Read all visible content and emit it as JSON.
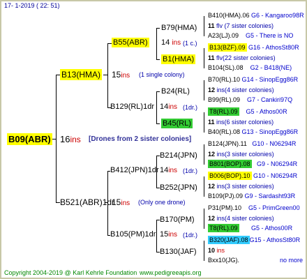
{
  "header": {
    "date": "17-  1-2019 ( 22: 51)"
  },
  "footer": {
    "copyright": "Copyright 2004-2019 @ Karl Kehrle Foundation",
    "site": "www.pedigreeapis.org"
  },
  "root": {
    "id": "B09(ABR)",
    "count": "16",
    "unit": "ins",
    "note": "[Drones from 2 sister colonies]"
  },
  "g1": [
    {
      "id": "B13(HMA)",
      "count": "15",
      "unit": "ins",
      "note": "(1 single colony)"
    },
    {
      "id": "B521(ABR)1dr",
      "count": "15",
      "unit": "ins",
      "note": "(Only one drone)"
    }
  ],
  "g2": [
    {
      "id": "B55(ABR)",
      "count": "14",
      "unit": "ins",
      "note": "(1 c.)"
    },
    {
      "id": "B129(RL)1dr",
      "count": "14",
      "unit": "ins",
      "note": "(1dr.)"
    },
    {
      "id": "B412(JPN)1dr",
      "count": "14",
      "unit": "ins",
      "note": "(1dr.)"
    },
    {
      "id": "B105(PM)1dr",
      "count": "15",
      "unit": "ins",
      "note": "(1dr.)"
    }
  ],
  "g3": [
    {
      "id": "B79(HMA)"
    },
    {
      "id": "B1(HMA)"
    },
    {
      "id": "B24(RL)"
    },
    {
      "id": "B45(RL)"
    },
    {
      "id": "B214(JPN)"
    },
    {
      "id": "B252(JPN)"
    },
    {
      "id": "B170(PM)"
    },
    {
      "id": "B130(JAF)"
    }
  ],
  "g4": [
    {
      "top": "B410(HMA).06",
      "topnote": "G6 - Kangaroo98R",
      "count": "11",
      "note": "flv (7 sister colonies)",
      "bot": "A23(LJ).09",
      "botnote": "G5 - There is NO"
    },
    {
      "top": "B13(BZF).09",
      "topnote": "G16 - AthosSt80R",
      "count": "11",
      "note": "flv(22 sister colonies)",
      "bot": "B104(SL).08",
      "botnote": "G2 - B418(NE)"
    },
    {
      "top": "B70(RL).10",
      "topnote": "G14 - SinopEgg86R",
      "count": "12",
      "note": "ins(4 sister colonies)",
      "bot": "B99(RL).09",
      "botnote": "G7 - Cankiri97Q"
    },
    {
      "top": "T8(RL).09",
      "topnote": "G5 - Athos00R",
      "count": "11",
      "note": "ins(6 sister colonies)",
      "bot": "B40(RL).08",
      "botnote": "G13 - SinopEgg86R"
    },
    {
      "top": "B124(JPN).11",
      "topnote": "G10 - N06294R",
      "count": "12",
      "note": "ins(3 sister colonies)",
      "bot": "B801(BOP).08",
      "botnote": "G9 - N06294R"
    },
    {
      "top": "B006(BOP).10",
      "topnote": "G10 - N06294R",
      "count": "12",
      "note": "ins(3 sister colonies)",
      "bot": "B109(PJ).09",
      "botnote": "G9 - Sardasht93R"
    },
    {
      "top": "P31(PM).10",
      "topnote": "G5 - PrimGreen00",
      "count": "12",
      "note": "ins(4 sister colonies)",
      "bot": "T8(RL).09",
      "botnote": "G5 - Athos00R"
    },
    {
      "top": "B320(JAF).08",
      "topnote": "G15 - AthosSt80R",
      "count": "10",
      "note": "ins",
      "bot": "Bxx10(JG).",
      "botnote": "no more"
    }
  ],
  "colors": {
    "yellow": "#ffff00",
    "green": "#33cc33",
    "cyan": "#33ccff",
    "blue": "#0000cc",
    "red": "#cc0000"
  }
}
